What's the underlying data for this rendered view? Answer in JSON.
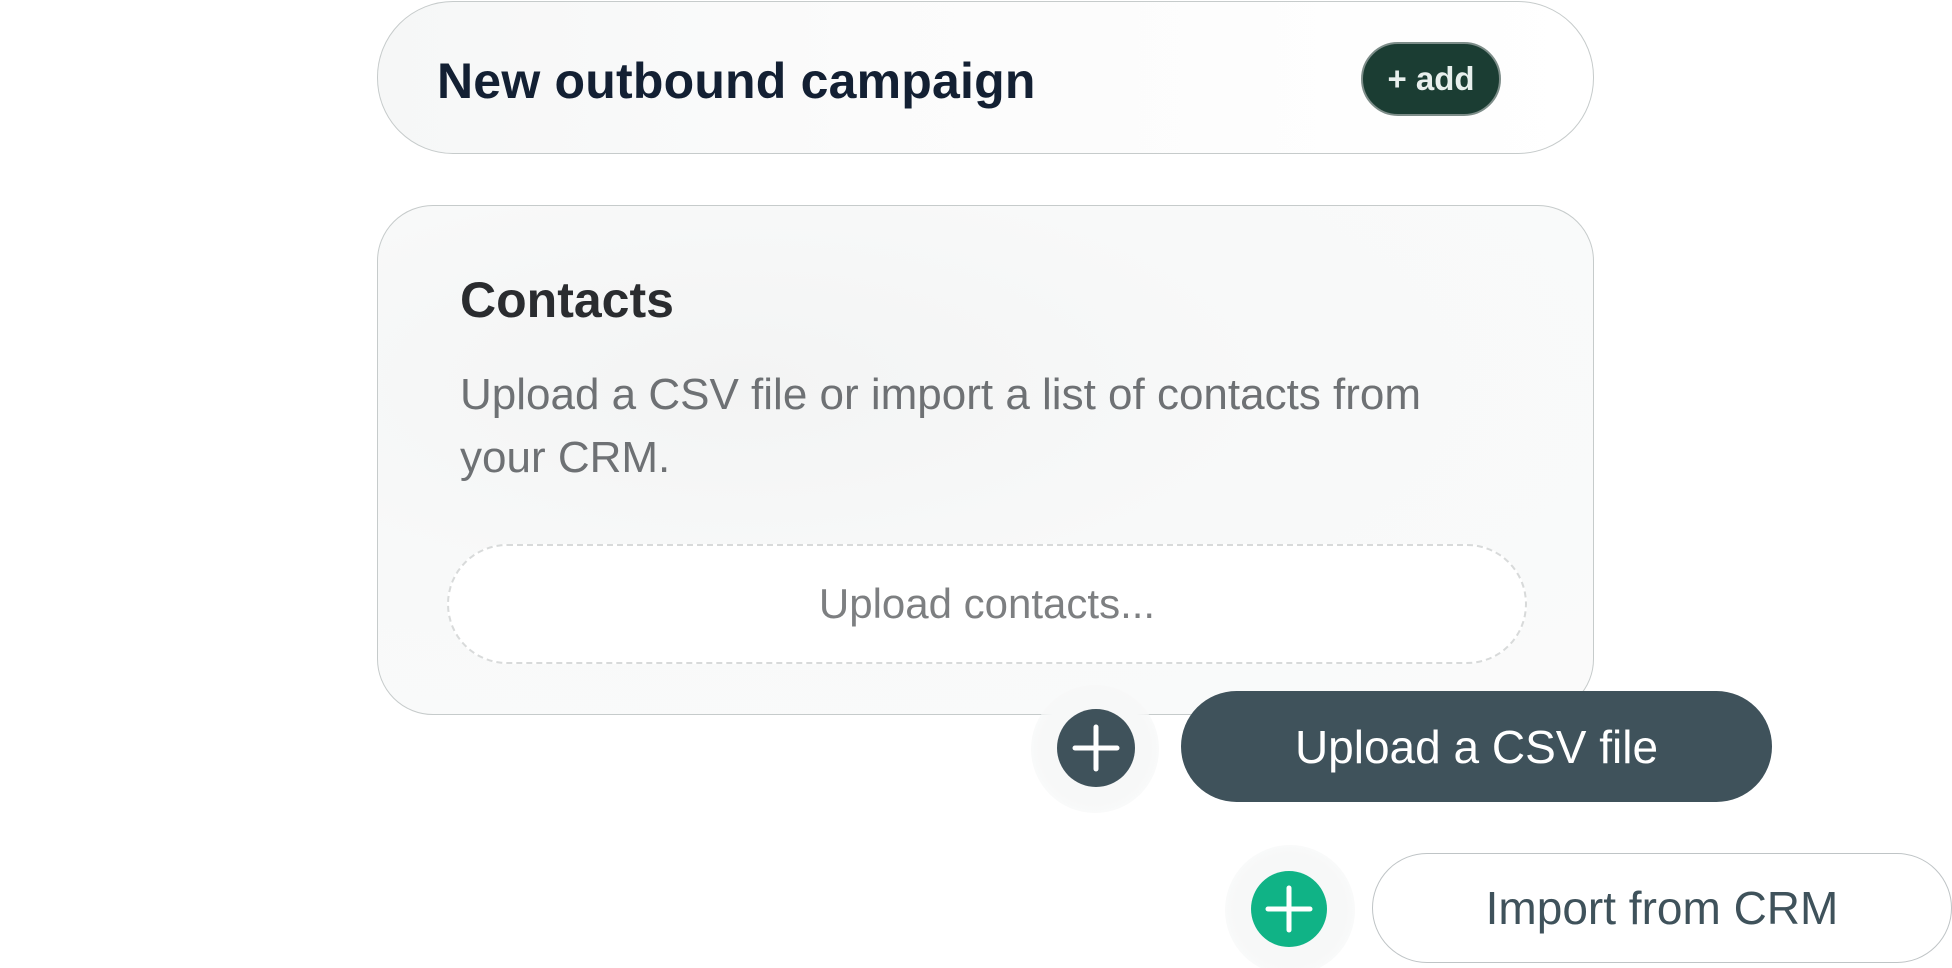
{
  "header": {
    "title": "New outbound campaign",
    "add_label": "+ add"
  },
  "contacts": {
    "title": "Contacts",
    "description": "Upload a CSV file or import a list of contacts from your CRM.",
    "upload_placeholder": "Upload contacts..."
  },
  "actions": {
    "csv_label": "Upload a CSV file",
    "crm_label": "Import from CRM",
    "csv_plus_icon": "plus-icon",
    "crm_plus_icon": "plus-icon"
  },
  "colors": {
    "dark_green": "#1b3d33",
    "slate": "#3f525b",
    "accent_green": "#10b386",
    "title_text": "#132033",
    "muted_text": "#6e7174"
  }
}
